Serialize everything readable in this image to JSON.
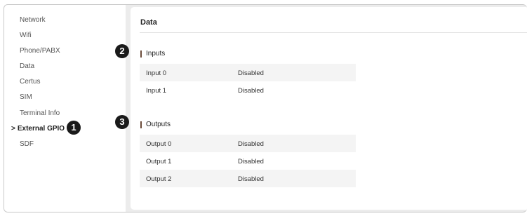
{
  "sidebar": {
    "items": [
      {
        "label": "Network"
      },
      {
        "label": "Wifi"
      },
      {
        "label": "Phone/PABX"
      },
      {
        "label": "Data"
      },
      {
        "label": "Certus"
      },
      {
        "label": "SIM"
      },
      {
        "label": "Terminal Info"
      },
      {
        "label": "External GPIO",
        "active": true
      },
      {
        "label": "SDF"
      }
    ],
    "active_arrow": ">"
  },
  "callouts": [
    "1",
    "2",
    "3"
  ],
  "main": {
    "title": "Data",
    "inputs": {
      "heading": "Inputs",
      "rows": [
        {
          "name": "Input 0",
          "value": "Disabled"
        },
        {
          "name": "Input 1",
          "value": "Disabled"
        }
      ]
    },
    "outputs": {
      "heading": "Outputs",
      "rows": [
        {
          "name": "Output 0",
          "value": "Disabled"
        },
        {
          "name": "Output 1",
          "value": "Disabled"
        },
        {
          "name": "Output 2",
          "value": "Disabled"
        }
      ]
    }
  },
  "colors": {
    "frame_bg": "#ececec",
    "section_bar": "#6b4b3a",
    "badge_bg": "#1a1a1a"
  }
}
